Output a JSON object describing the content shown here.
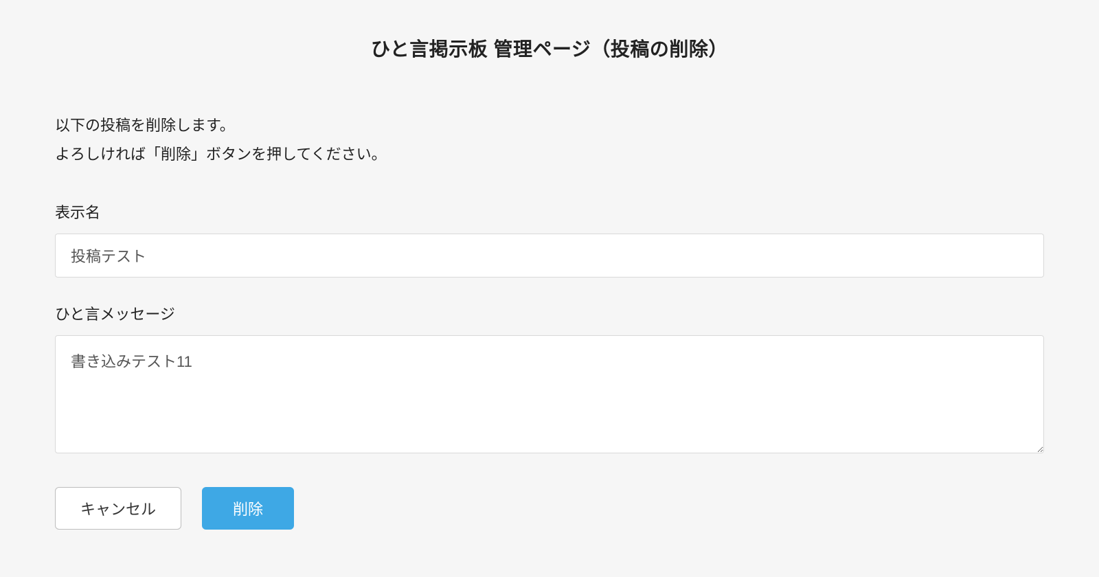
{
  "header": {
    "title": "ひと言掲示板 管理ページ（投稿の削除）"
  },
  "description": {
    "line1": "以下の投稿を削除します。",
    "line2": "よろしければ「削除」ボタンを押してください。"
  },
  "form": {
    "displayName": {
      "label": "表示名",
      "value": "投稿テスト"
    },
    "message": {
      "label": "ひと言メッセージ",
      "value": "書き込みテスト11"
    }
  },
  "actions": {
    "cancel": "キャンセル",
    "delete": "削除"
  }
}
